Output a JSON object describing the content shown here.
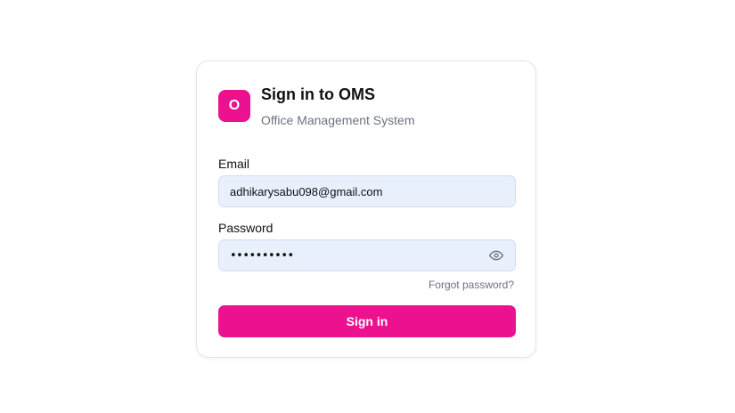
{
  "brand": {
    "logo_letter": "O",
    "title": "Sign in to OMS",
    "subtitle": "Office Management System",
    "accent_color": "#ec118f"
  },
  "form": {
    "email_label": "Email",
    "email_value": "adhikarysabu098@gmail.com",
    "password_label": "Password",
    "password_masked": "••••••••••",
    "password_toggle_icon": "eye-icon",
    "forgot_password_label": "Forgot password?",
    "submit_label": "Sign in"
  }
}
